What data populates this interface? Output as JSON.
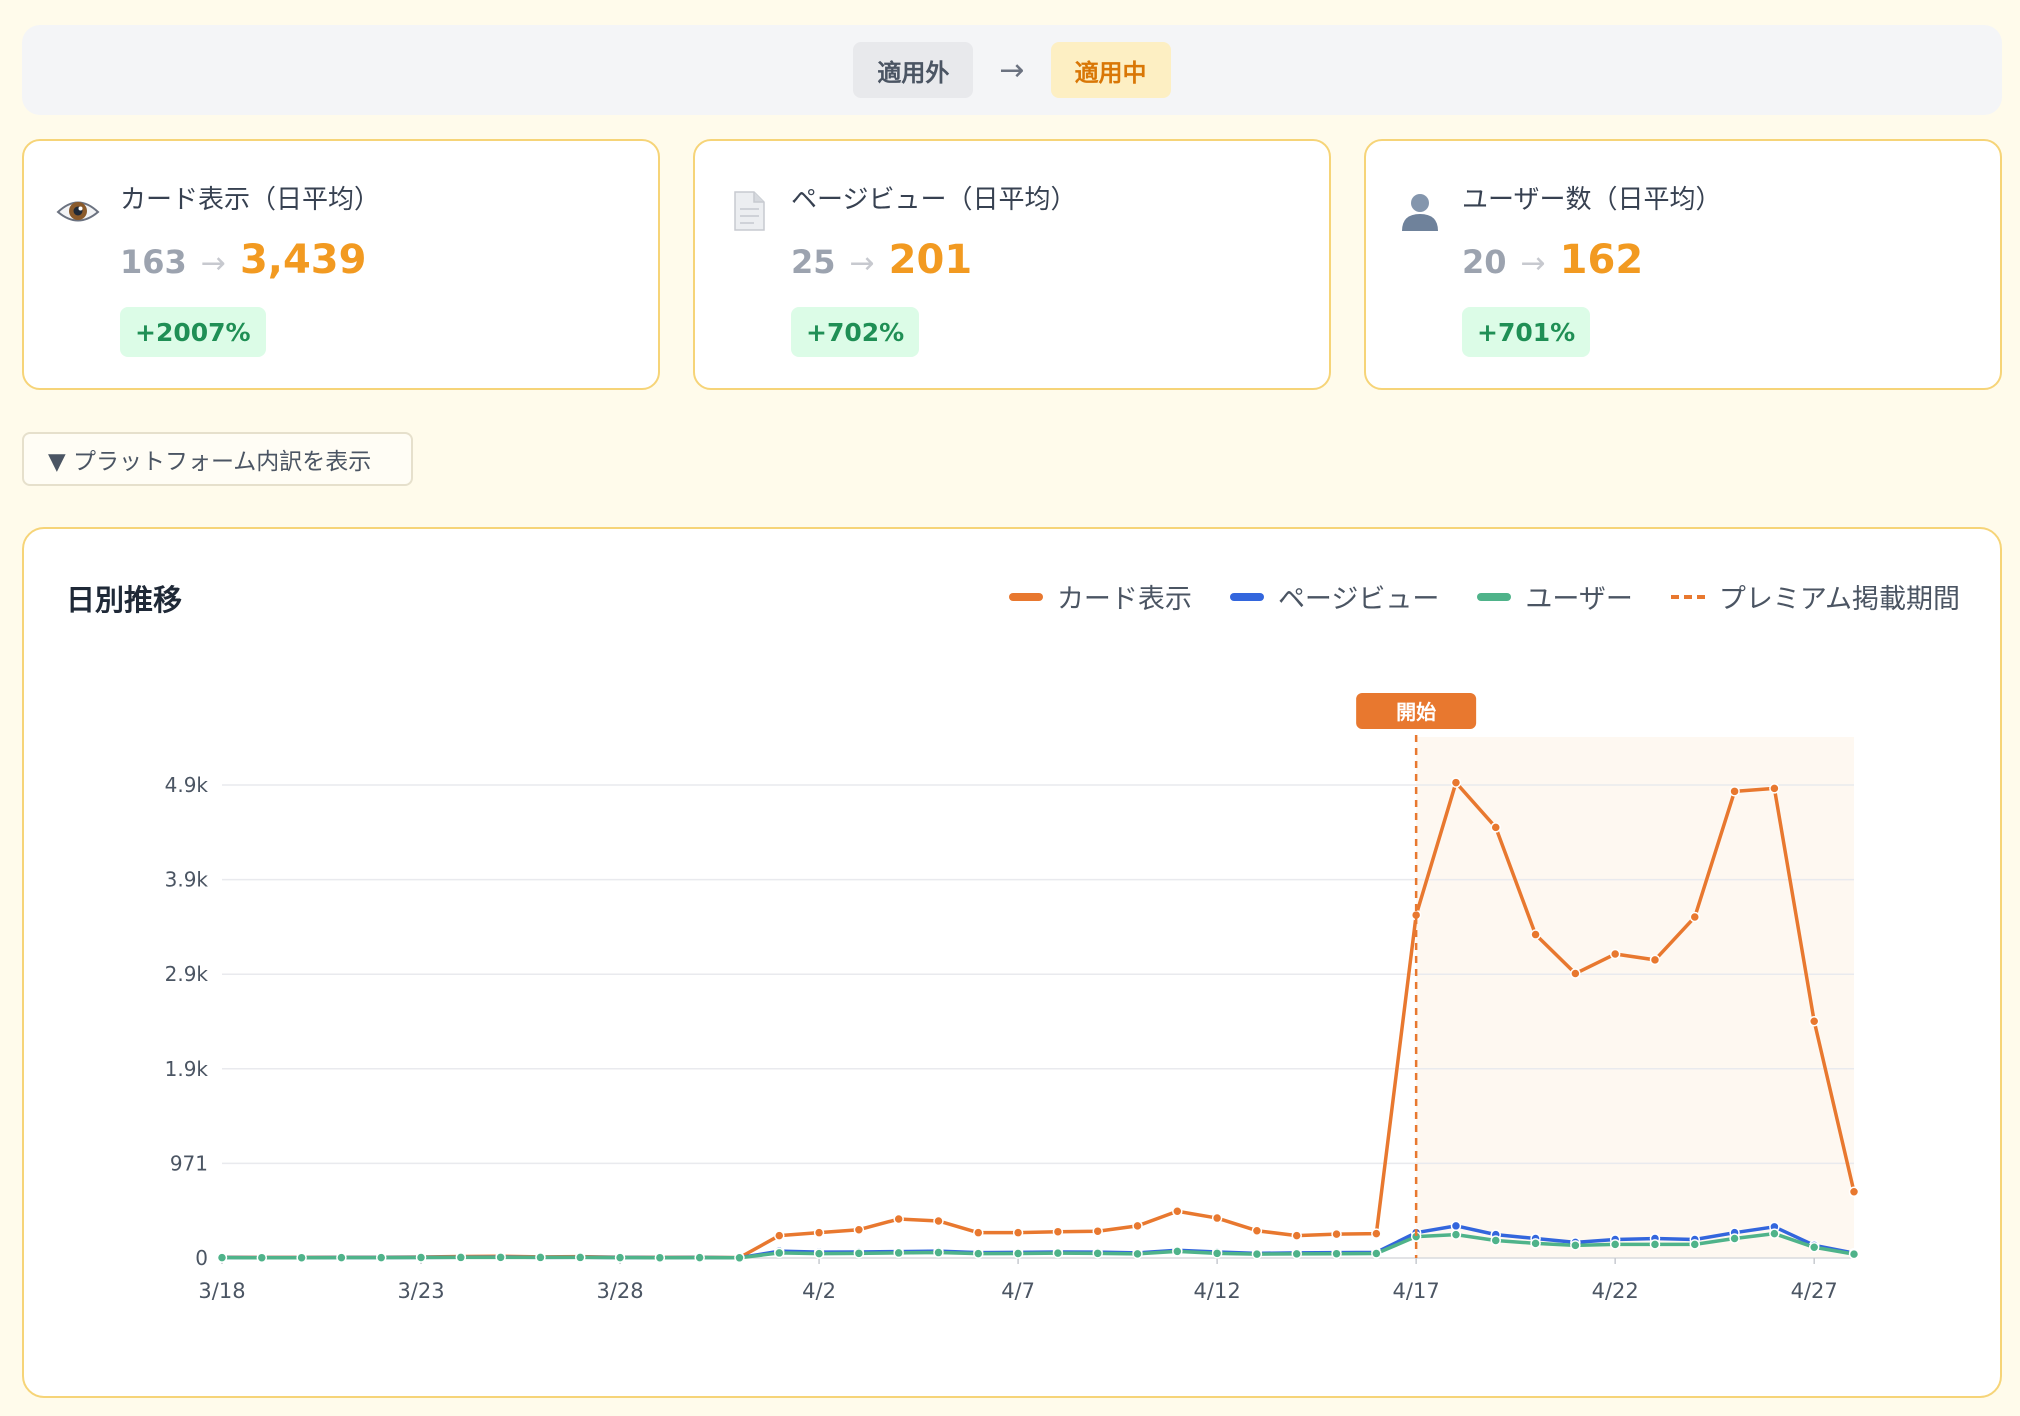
{
  "status": {
    "inactive_label": "適用外",
    "arrow": "→",
    "active_label": "適用中"
  },
  "cards": [
    {
      "icon": "eye-icon",
      "label": "カード表示（日平均）",
      "before": "163",
      "arrow": "→",
      "after": "3,439",
      "badge": "+2007%"
    },
    {
      "icon": "document-icon",
      "label": "ページビュー（日平均）",
      "before": "25",
      "arrow": "→",
      "after": "201",
      "badge": "+702%"
    },
    {
      "icon": "user-icon",
      "label": "ユーザー数（日平均）",
      "before": "20",
      "arrow": "→",
      "after": "162",
      "badge": "+701%"
    }
  ],
  "breakdown_button": "▼ プラットフォーム内訳を表示",
  "colors": {
    "card": "#e8782f",
    "page": "#3366dd",
    "user": "#4fb38a",
    "accent": "#f29a21"
  },
  "chart_data": {
    "type": "line",
    "title": "日別推移",
    "legend": [
      "カード表示",
      "ページビュー",
      "ユーザー",
      "プレミアム掲載期間"
    ],
    "legend_position": "top-right",
    "y_ticks": [
      "0",
      "971",
      "1.9k",
      "2.9k",
      "3.9k",
      "4.9k"
    ],
    "y_tick_values": [
      0,
      971,
      1942,
      2913,
      3884,
      4855
    ],
    "ylim": [
      0,
      4855
    ],
    "x": [
      "3/18",
      "3/19",
      "3/20",
      "3/21",
      "3/22",
      "3/23",
      "3/24",
      "3/25",
      "3/26",
      "3/27",
      "3/28",
      "3/29",
      "3/30",
      "3/31",
      "4/1",
      "4/2",
      "4/3",
      "4/4",
      "4/5",
      "4/6",
      "4/7",
      "4/8",
      "4/9",
      "4/10",
      "4/11",
      "4/12",
      "4/13",
      "4/14",
      "4/15",
      "4/16",
      "4/17",
      "4/18",
      "4/19",
      "4/20",
      "4/21",
      "4/22",
      "4/23",
      "4/24",
      "4/25",
      "4/26",
      "4/27",
      "4/28"
    ],
    "x_tick_labels": [
      "3/18",
      "3/23",
      "3/28",
      "4/2",
      "4/7",
      "4/12",
      "4/17",
      "4/22",
      "4/27"
    ],
    "series": [
      {
        "name": "カード表示",
        "values": [
          8,
          6,
          6,
          8,
          8,
          10,
          15,
          18,
          12,
          14,
          8,
          6,
          8,
          4,
          230,
          260,
          290,
          400,
          380,
          260,
          260,
          270,
          275,
          330,
          480,
          410,
          280,
          230,
          245,
          250,
          3520,
          4880,
          4420,
          3320,
          2920,
          3120,
          3060,
          3500,
          4790,
          4820,
          2430,
          680
        ]
      },
      {
        "name": "ページビュー",
        "values": [
          5,
          4,
          4,
          5,
          5,
          6,
          8,
          9,
          7,
          8,
          5,
          4,
          5,
          3,
          70,
          60,
          62,
          66,
          70,
          55,
          58,
          62,
          60,
          52,
          80,
          62,
          48,
          52,
          55,
          58,
          260,
          330,
          240,
          200,
          160,
          190,
          200,
          190,
          260,
          320,
          130,
          50
        ]
      },
      {
        "name": "ユーザー",
        "values": [
          4,
          3,
          3,
          4,
          4,
          5,
          6,
          7,
          6,
          6,
          4,
          3,
          4,
          2,
          52,
          45,
          48,
          52,
          56,
          45,
          46,
          50,
          48,
          42,
          68,
          48,
          40,
          42,
          44,
          46,
          220,
          240,
          180,
          150,
          130,
          140,
          140,
          140,
          200,
          250,
          110,
          40
        ]
      }
    ],
    "premium_period": {
      "start": "4/17",
      "end": "4/28",
      "label": "開始"
    }
  }
}
